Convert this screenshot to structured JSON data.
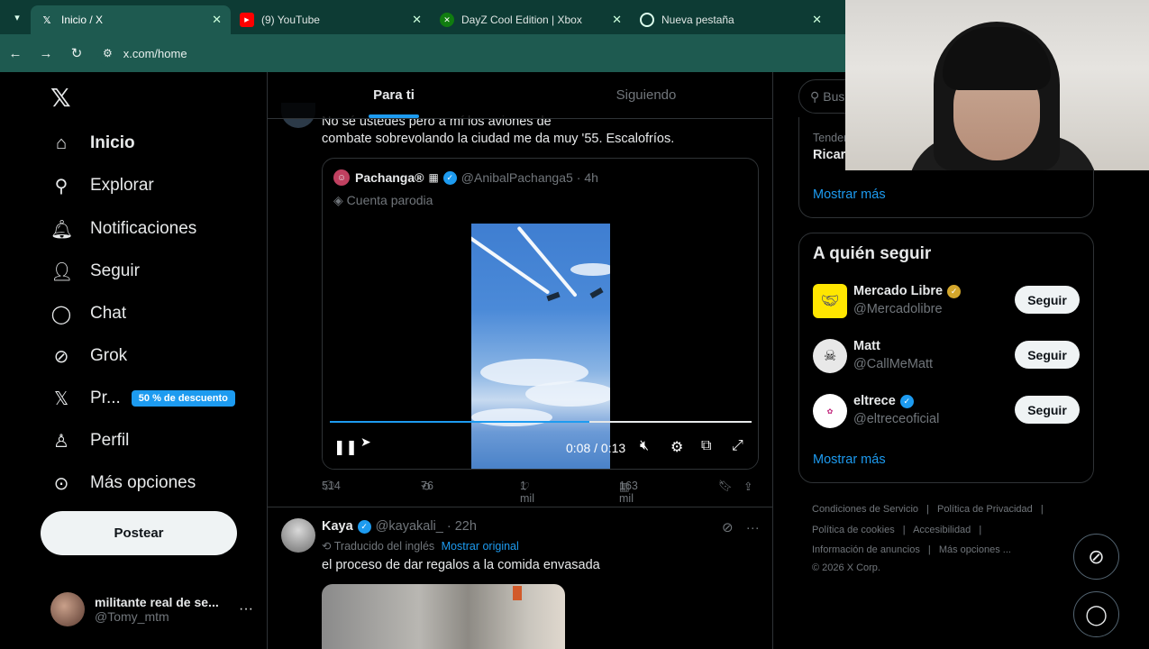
{
  "browser": {
    "tabs": [
      {
        "title": "Inicio / X",
        "icon": "x-icon",
        "active": true
      },
      {
        "title": "(9) YouTube",
        "icon": "youtube-icon",
        "active": false
      },
      {
        "title": "DayZ Cool Edition | Xbox",
        "icon": "xbox-icon",
        "active": false
      },
      {
        "title": "Nueva pestaña",
        "icon": "chrome-icon",
        "active": false
      }
    ],
    "url": "x.com/home"
  },
  "nav": {
    "items": [
      {
        "label": "Inicio",
        "icon": "home-icon"
      },
      {
        "label": "Explorar",
        "icon": "search-icon"
      },
      {
        "label": "Notificaciones",
        "icon": "bell-icon"
      },
      {
        "label": "Seguir",
        "icon": "follow-icon"
      },
      {
        "label": "Chat",
        "icon": "chat-icon"
      },
      {
        "label": "Grok",
        "icon": "grok-icon"
      },
      {
        "label": "Pr...",
        "icon": "x-premium-icon"
      },
      {
        "label": "Perfil",
        "icon": "profile-icon"
      },
      {
        "label": "Más opciones",
        "icon": "more-icon"
      }
    ],
    "promo_badge": "50 % de descuento",
    "post_button": "Postear",
    "account": {
      "name": "militante real de se...",
      "handle": "@Tomy_mtm"
    }
  },
  "feed": {
    "tabs": [
      "Para ti",
      "Siguiendo"
    ],
    "post1": {
      "text_line1": "No sé ustedes pero a mí los aviones de",
      "text_line2": "combate sobrevolando la ciudad me da muy '55. Escalofríos.",
      "quote": {
        "name": "Pachanga®",
        "handle": "@AnibalPachanga5",
        "time": "· 4h",
        "label": "Cuenta parodia",
        "video_time": "0:08 / 0:13",
        "video_progress": 0.615
      },
      "stats": {
        "replies": "514",
        "reposts": "76",
        "likes": "1 mil",
        "views": "163 mil"
      }
    },
    "post2": {
      "name": "Kaya",
      "handle": "@kayakali_",
      "time": "· 22h",
      "translated": "Traducido del inglés",
      "show_original": "Mostrar original",
      "text": "el proceso de dar regalos a la comida envasada"
    }
  },
  "right": {
    "search_placeholder": "Bus",
    "trend": {
      "context": "Tender",
      "name": "Ricar"
    },
    "show_more": "Mostrar más",
    "who_to_follow": {
      "title": "A quién seguir",
      "accounts": [
        {
          "name": "Mercado Libre",
          "handle": "@Mercadolibre",
          "badge": "gold"
        },
        {
          "name": "Matt",
          "handle": "@CallMeMatt",
          "badge": "none"
        },
        {
          "name": "eltrece",
          "handle": "@eltreceoficial",
          "badge": "blue"
        }
      ],
      "follow_label": "Seguir",
      "show_more": "Mostrar más"
    },
    "footer": {
      "line1": [
        "Condiciones de Servicio",
        "|",
        "Política de Privacidad",
        "|"
      ],
      "line2": [
        "Política de cookies",
        "|",
        "Accesibilidad",
        "|"
      ],
      "line3": [
        "Información de anuncios",
        "|",
        "Más opciones ..."
      ],
      "line4": "© 2026 X Corp."
    }
  },
  "colors": {
    "accent": "#1d9bf0",
    "background": "#000000",
    "chrome": "#1e5a50"
  }
}
